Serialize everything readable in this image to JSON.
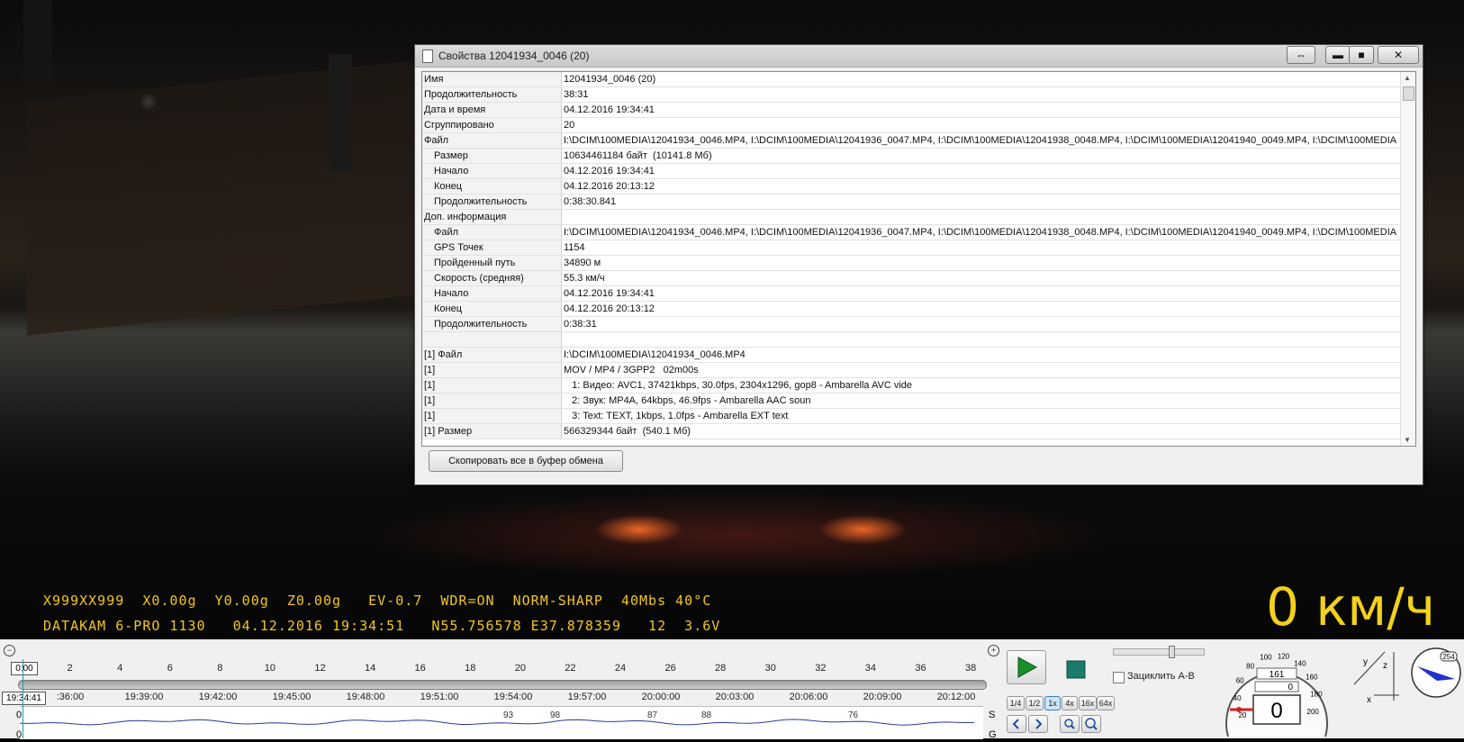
{
  "osd": {
    "line1": "X999XX999  X0.00g  Y0.00g  Z0.00g   EV-0.7  WDR=ON  NORM-SHARP  40Mbs 40°C",
    "line2": "DATAKAM 6-PRO 1130   04.12.2016 19:34:51   N55.756578 E37.878359   12  3.6V",
    "speed": "0 км/ч"
  },
  "window": {
    "title": "Свойства 12041934_0046 (20)",
    "resize_label": "⇔",
    "min_label": "▬",
    "max_label": "■",
    "close_label": "✕",
    "copy_button": "Скопировать все в буфер обмена"
  },
  "rows": [
    {
      "k": "Имя",
      "v": "12041934_0046 (20)",
      "ind": false
    },
    {
      "k": "Продолжительность",
      "v": "38:31",
      "ind": false
    },
    {
      "k": "Дата и время",
      "v": "04.12.2016 19:34:41",
      "ind": false
    },
    {
      "k": "Сгруппировано",
      "v": "20",
      "ind": false
    },
    {
      "k": "Файл",
      "v": "I:\\DCIM\\100MEDIA\\12041934_0046.MP4, I:\\DCIM\\100MEDIA\\12041936_0047.MP4, I:\\DCIM\\100MEDIA\\12041938_0048.MP4, I:\\DCIM\\100MEDIA\\12041940_0049.MP4, I:\\DCIM\\100MEDIA",
      "ind": false
    },
    {
      "k": "Размер",
      "v": "10634461184 байт  (10141.8 Мб)",
      "ind": true
    },
    {
      "k": "Начало",
      "v": "04.12.2016 19:34:41",
      "ind": true
    },
    {
      "k": "Конец",
      "v": "04.12.2016 20:13:12",
      "ind": true
    },
    {
      "k": "Продолжительность",
      "v": "0:38:30.841",
      "ind": true
    },
    {
      "k": "Доп. информация",
      "v": "",
      "ind": false
    },
    {
      "k": "Файл",
      "v": "I:\\DCIM\\100MEDIA\\12041934_0046.MP4, I:\\DCIM\\100MEDIA\\12041936_0047.MP4, I:\\DCIM\\100MEDIA\\12041938_0048.MP4, I:\\DCIM\\100MEDIA\\12041940_0049.MP4, I:\\DCIM\\100MEDIA",
      "ind": true
    },
    {
      "k": "GPS Точек",
      "v": "1154",
      "ind": true
    },
    {
      "k": "Пройденный путь",
      "v": "34890 м",
      "ind": true
    },
    {
      "k": "Скорость (средняя)",
      "v": "55.3 км/ч",
      "ind": true
    },
    {
      "k": "Начало",
      "v": "04.12.2016 19:34:41",
      "ind": true
    },
    {
      "k": "Конец",
      "v": "04.12.2016 20:13:12",
      "ind": true
    },
    {
      "k": "Продолжительность",
      "v": "0:38:31",
      "ind": true
    },
    {
      "k": "",
      "v": "",
      "ind": false
    },
    {
      "k": "[1] Файл",
      "v": "I:\\DCIM\\100MEDIA\\12041934_0046.MP4",
      "ind": false
    },
    {
      "k": "[1]",
      "v": "MOV / MP4 / 3GPP2   02m00s",
      "ind": false
    },
    {
      "k": "[1]",
      "v": "   1: Видео: AVC1, 37421kbps, 30.0fps, 2304x1296, gop8 - Ambarella AVC vide",
      "ind": false
    },
    {
      "k": "[1]",
      "v": "   2: Звук: MP4A, 64kbps, 46.9fps - Ambarella AAC soun",
      "ind": false
    },
    {
      "k": "[1]",
      "v": "   3: Text: TEXT, 1kbps, 1.0fps - Ambarella EXT text",
      "ind": false
    },
    {
      "k": "[1]     Размер",
      "v": "566329344 байт  (540.1 Мб)",
      "ind": false
    }
  ],
  "timeline": {
    "current_minute": "0:00",
    "minute_ticks": [
      "2",
      "4",
      "6",
      "8",
      "10",
      "12",
      "14",
      "16",
      "18",
      "20",
      "22",
      "24",
      "26",
      "28",
      "30",
      "32",
      "34",
      "36",
      "38"
    ],
    "current_time": "19:34:41",
    "time_ticks": [
      ":36:00",
      "19:39:00",
      "19:42:00",
      "19:45:00",
      "19:48:00",
      "19:51:00",
      "19:54:00",
      "19:57:00",
      "20:00:00",
      "20:03:00",
      "20:06:00",
      "20:09:00",
      "20:12:00"
    ],
    "graph_values": [
      "93",
      "98",
      "87",
      "88",
      "76"
    ],
    "label_s": "S",
    "label_g": "G",
    "zero_a": "0",
    "zero_b": "0"
  },
  "controls": {
    "speeds": [
      "1/4",
      "1/2",
      "1x",
      "4x",
      "16x",
      "64x"
    ],
    "active_speed": "1x",
    "loop_label": "Зациклить A-B"
  },
  "speedometer": {
    "ticks": [
      "20",
      "40",
      "60",
      "80",
      "100",
      "120",
      "140",
      "160",
      "180",
      "200"
    ],
    "odometer": "161",
    "trip": "0",
    "value": "0"
  },
  "axes_labels": {
    "x": "x",
    "y": "y",
    "z": "z"
  },
  "compass": {
    "value": "254"
  },
  "colors": {
    "osd": "#f2c61a",
    "play": "#1a8f2a",
    "stop": "#1b7a6a"
  }
}
